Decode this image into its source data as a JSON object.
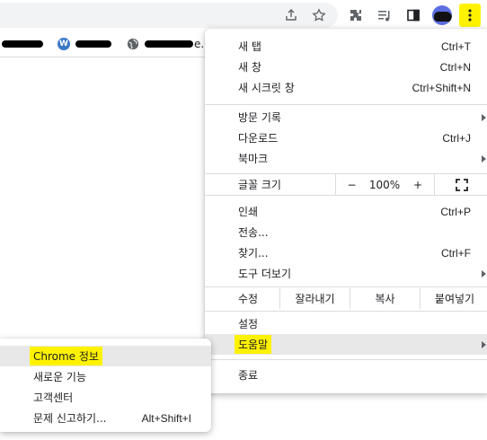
{
  "bookmarks": {
    "items": [
      {
        "icon": "redacted-icon",
        "label": ""
      },
      {
        "icon": "wordpress-icon",
        "label": ""
      },
      {
        "icon": "globe-icon",
        "label": "e.co.k"
      }
    ]
  },
  "menu": {
    "new_tab": {
      "label": "새 탭",
      "shortcut": "Ctrl+T"
    },
    "new_window": {
      "label": "새 창",
      "shortcut": "Ctrl+N"
    },
    "new_incognito": {
      "label": "새 시크릿 창",
      "shortcut": "Ctrl+Shift+N"
    },
    "history": {
      "label": "방문 기록"
    },
    "downloads": {
      "label": "다운로드",
      "shortcut": "Ctrl+J"
    },
    "bookmarks": {
      "label": "북마크"
    },
    "zoom": {
      "label": "글꼴 크기",
      "minus": "−",
      "value": "100%",
      "plus": "+"
    },
    "print": {
      "label": "인쇄",
      "shortcut": "Ctrl+P"
    },
    "cast": {
      "label": "전송..."
    },
    "find": {
      "label": "찾기...",
      "shortcut": "Ctrl+F"
    },
    "more_tools": {
      "label": "도구 더보기"
    },
    "edit": {
      "label": "수정",
      "cut": "잘라내기",
      "copy": "복사",
      "paste": "붙여넣기"
    },
    "settings": {
      "label": "설정"
    },
    "help": {
      "label": "도움말"
    },
    "exit": {
      "label": "종료"
    }
  },
  "help_submenu": {
    "about": {
      "label": "Chrome 정보"
    },
    "whats_new": {
      "label": "새로운 기능"
    },
    "help_center": {
      "label": "고객센터"
    },
    "report_issue": {
      "label": "문제 신고하기...",
      "shortcut": "Alt+Shift+I"
    }
  },
  "colors": {
    "highlight": "#fff200",
    "hover": "#e8e8e8",
    "separator": "#dadce0"
  }
}
